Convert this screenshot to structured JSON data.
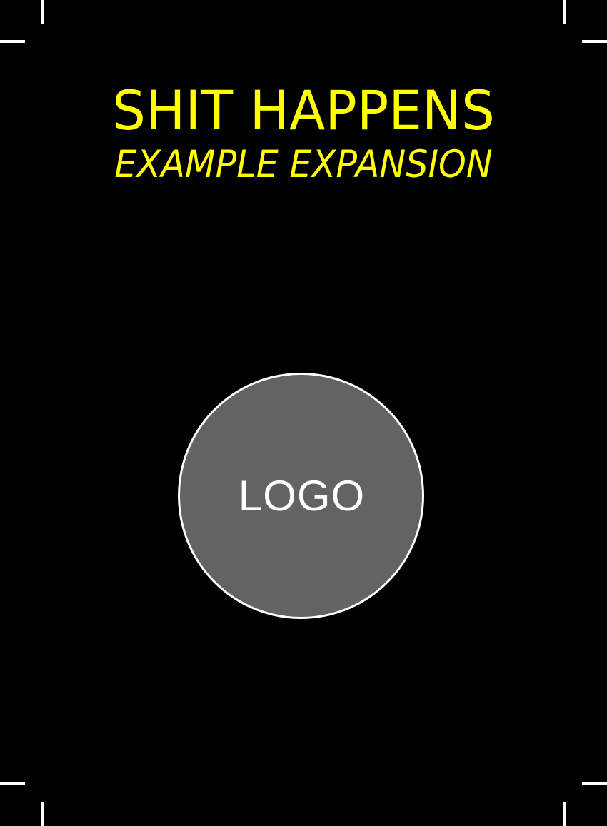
{
  "card": {
    "title": "SHIT HAPPENS",
    "subtitle": "EXAMPLE EXPANSION",
    "logo_text": "LOGO"
  },
  "colors": {
    "background": "#000000",
    "title": "#ffff00",
    "logo_fill": "#636363",
    "logo_border": "#ffffff",
    "crop_marks": "#ffffff"
  },
  "icons": {
    "logo": "logo-placeholder-circle",
    "crop_marks": "crop-mark"
  }
}
